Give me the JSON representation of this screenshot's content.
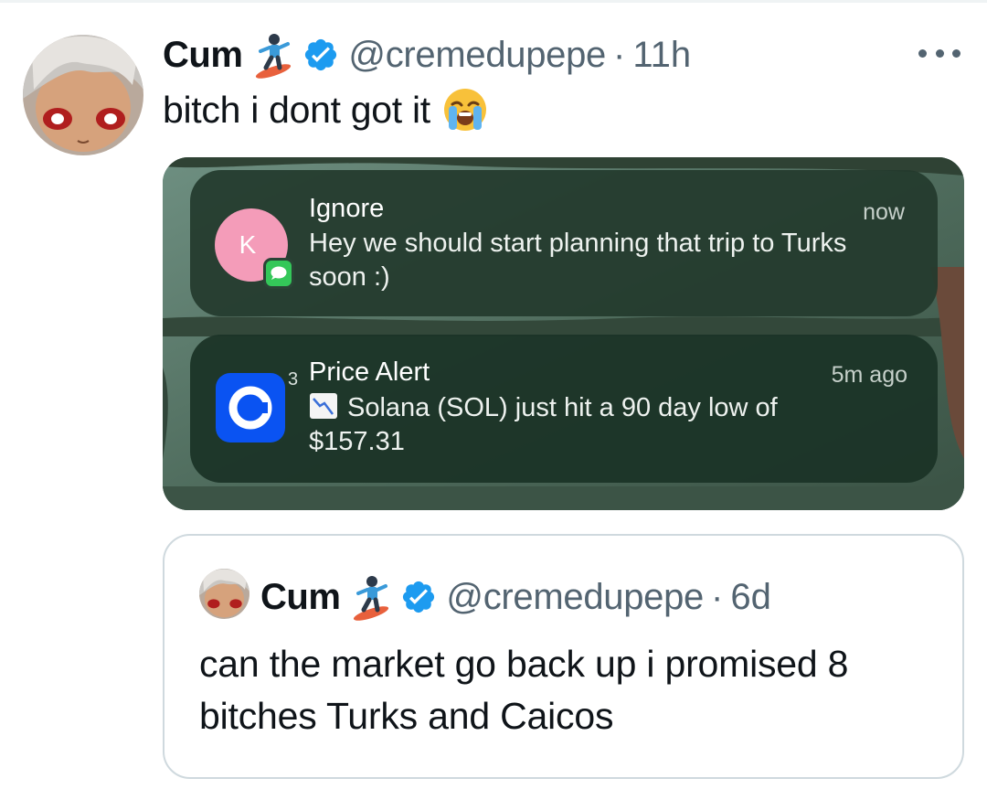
{
  "tweet": {
    "author_name": "Cum",
    "author_emoji": "snowboarder-emoji",
    "verified_icon": "verified-badge-icon",
    "handle": "@cremedupepe",
    "separator": "·",
    "time": "11h",
    "text": "bitch i dont got it",
    "text_emoji": "loudly-crying-face-emoji",
    "more_icon": "more-options-icon"
  },
  "media": {
    "notifications": [
      {
        "app_icon": "messages-icon",
        "avatar_initial": "K",
        "title": "Ignore",
        "body": "Hey we should start planning that trip to Turks soon :)",
        "time": "now"
      },
      {
        "app_icon": "coinbase-icon",
        "stack_count": "3",
        "title": "Price Alert",
        "body_icon": "chart-decreasing-emoji",
        "body": "Solana (SOL) just hit a 90 day low of $157.31",
        "time": "5m ago"
      }
    ]
  },
  "quote": {
    "author_name": "Cum",
    "author_emoji": "snowboarder-emoji",
    "verified_icon": "verified-badge-icon",
    "handle": "@cremedupepe",
    "separator": "·",
    "time": "6d",
    "text": "can the market go back up i promised 8 bitches Turks and Caicos"
  },
  "colors": {
    "text_primary": "#0f1419",
    "text_secondary": "#536471",
    "verified_blue": "#1d9bf0",
    "quote_border": "#cfd9de",
    "notification_bg": "#233a2d",
    "coinbase_blue": "#0a53f2",
    "contact_pink": "#f49cb9",
    "messages_green": "#34c759"
  }
}
